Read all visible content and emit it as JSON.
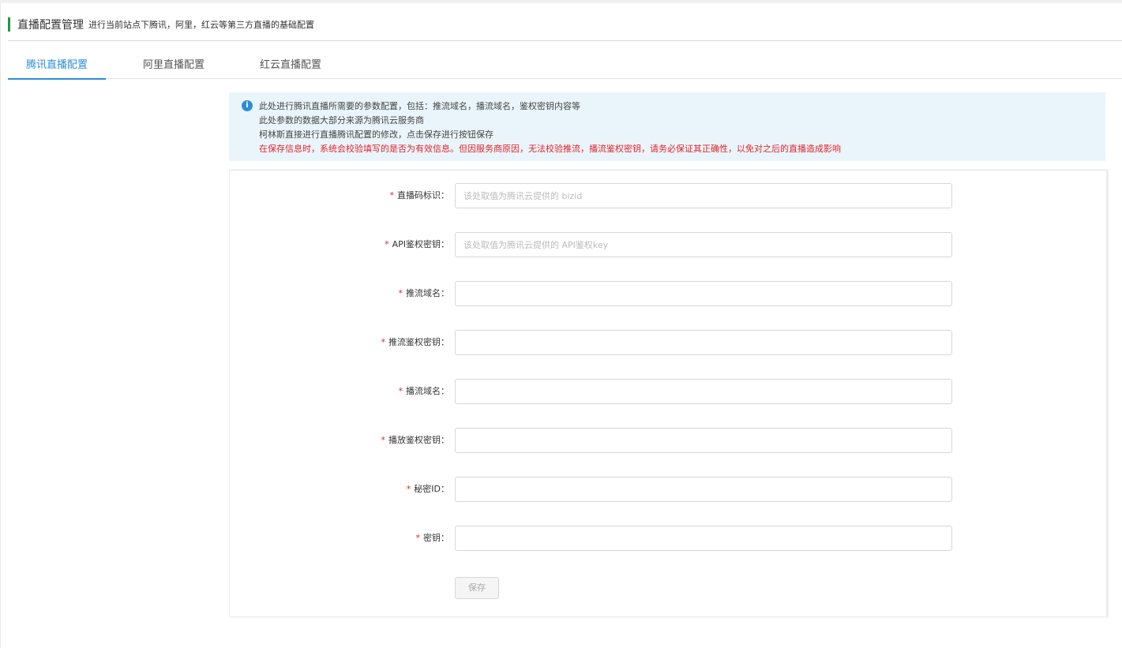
{
  "header": {
    "title": "直播配置管理",
    "subtitle": "进行当前站点下腾讯，阿里，红云等第三方直播的基础配置"
  },
  "tabs": [
    {
      "label": "腾讯直播配置",
      "active": true
    },
    {
      "label": "阿里直播配置",
      "active": false
    },
    {
      "label": "红云直播配置",
      "active": false
    }
  ],
  "notice": {
    "icon": "info-icon",
    "icon_glyph": "i",
    "lines": [
      "此处进行腾讯直播所需要的参数配置，包括：推流域名，播流域名，鉴权密钥内容等",
      "此处参数的数据大部分来源为腾讯云服务商",
      "柯林斯直接进行直播腾讯配置的修改，点击保存进行按钮保存"
    ],
    "warning": "在保存信息时，系统会校验填写的是否为有效信息。但因服务商原因，无法校验推流，播流鉴权密钥，请务必保证其正确性，以免对之后的直播造成影响"
  },
  "form": {
    "required_mark": "*",
    "fields": [
      {
        "label": "直播码标识：",
        "value": "",
        "placeholder": "该处取值为腾讯云提供的 bizid"
      },
      {
        "label": "API鉴权密钥：",
        "value": "",
        "placeholder": "该处取值为腾讯云提供的 API鉴权key"
      },
      {
        "label": "推流域名：",
        "value": "",
        "placeholder": ""
      },
      {
        "label": "推流鉴权密钥：",
        "value": "",
        "placeholder": ""
      },
      {
        "label": "播流域名：",
        "value": "",
        "placeholder": ""
      },
      {
        "label": "播放鉴权密钥：",
        "value": "",
        "placeholder": ""
      },
      {
        "label": "秘密ID：",
        "value": "",
        "placeholder": ""
      },
      {
        "label": "密钥：",
        "value": "",
        "placeholder": ""
      }
    ],
    "save_label": "保存"
  },
  "colors": {
    "accent": "#2b8fd8",
    "header_bar": "#1c9a4a",
    "required": "#e2242a",
    "notice_bg": "#eaf5fb"
  }
}
